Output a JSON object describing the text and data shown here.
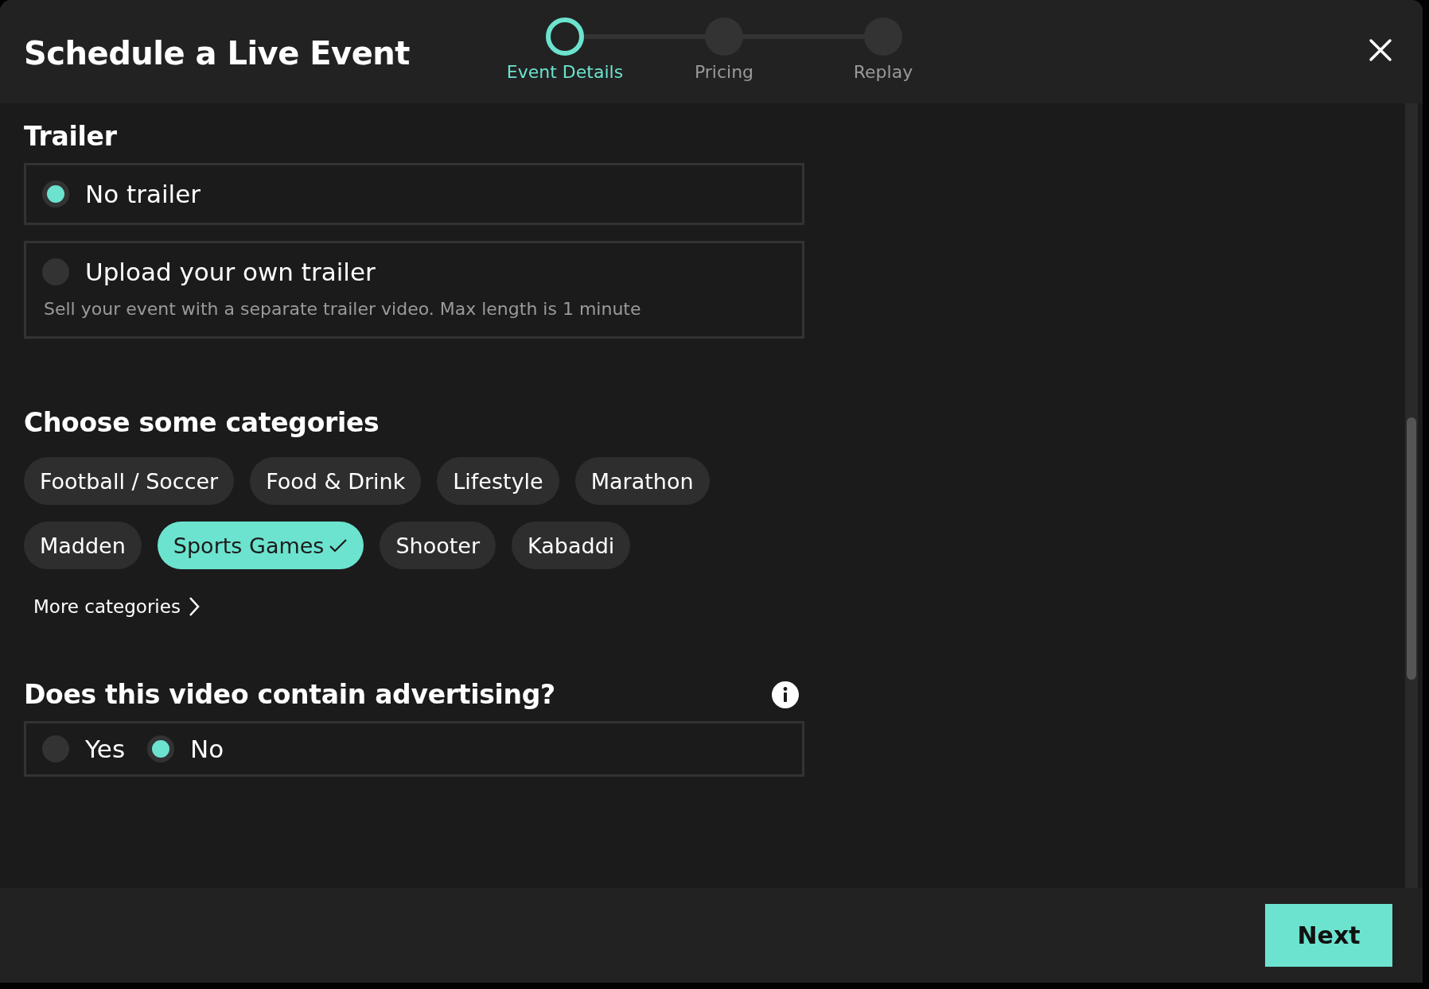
{
  "window": {
    "title": "Schedule a Live Event"
  },
  "steps": [
    {
      "label": "Event Details",
      "selected": true
    },
    {
      "label": "Pricing",
      "selected": false
    },
    {
      "label": "Replay",
      "selected": false
    }
  ],
  "trailer": {
    "heading": "Trailer",
    "options": [
      {
        "label": "No trailer",
        "selected": true
      },
      {
        "label": "Upload your own trailer",
        "description": "Sell your event with a separate trailer video. Max length is 1 minute",
        "selected": false
      }
    ]
  },
  "categories": {
    "heading": "Choose some categories",
    "chips": [
      {
        "label": "Football / Soccer",
        "selected": false
      },
      {
        "label": "Food & Drink",
        "selected": false
      },
      {
        "label": "Lifestyle",
        "selected": false
      },
      {
        "label": "Marathon",
        "selected": false
      },
      {
        "label": "Madden",
        "selected": false
      },
      {
        "label": "Sports Games",
        "selected": true
      },
      {
        "label": "Shooter",
        "selected": false
      },
      {
        "label": "Kabaddi",
        "selected": false
      }
    ],
    "more_link": "More categories"
  },
  "advertising": {
    "heading": "Does this video contain advertising?",
    "options": [
      {
        "label": "Yes",
        "selected": false
      },
      {
        "label": "No",
        "selected": true
      }
    ]
  },
  "footer": {
    "next_button": "Next"
  }
}
